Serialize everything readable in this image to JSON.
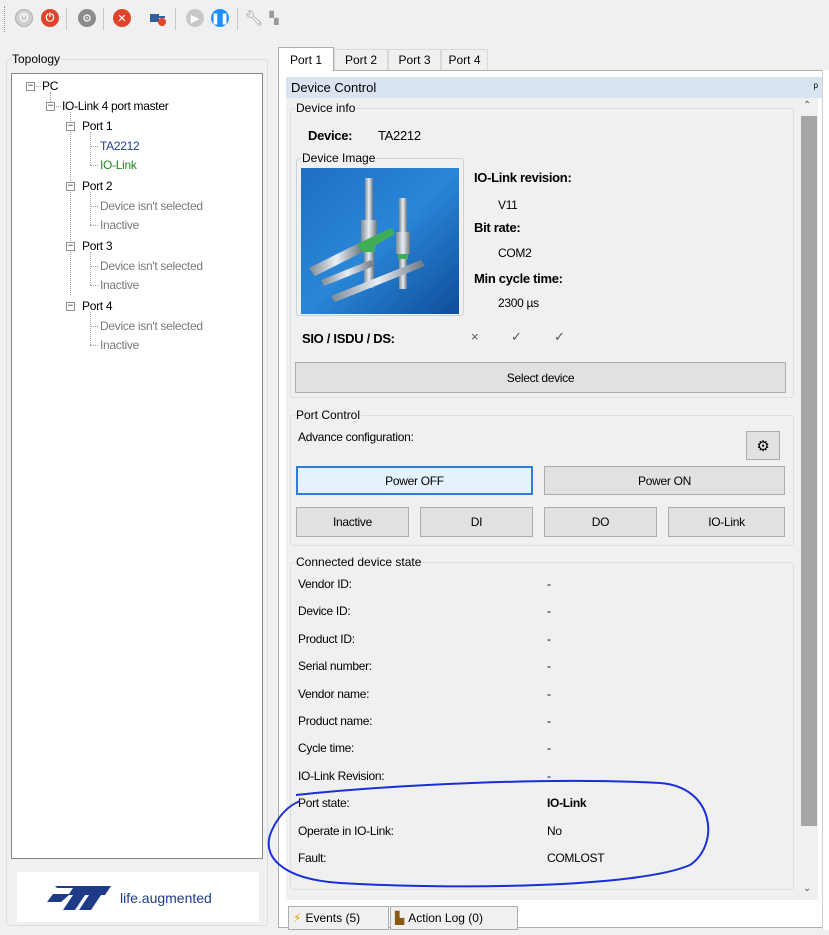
{
  "toolbar": {
    "buttons": [
      {
        "icon": "power-disabled-icon",
        "color": "#c8c8c8"
      },
      {
        "icon": "power-icon",
        "color": "#e0442a"
      },
      {
        "icon": "settings-gear-icon",
        "color": "#7a7a7a"
      },
      {
        "icon": "stop-icon",
        "color": "#e0442a"
      },
      {
        "icon": "disconnect-plug-icon",
        "color": "#2f5f9e"
      },
      {
        "icon": "play-disabled-icon",
        "color": "#c8c8c8"
      },
      {
        "icon": "pause-icon",
        "color": "#1e90ff"
      },
      {
        "icon": "wrench-icon",
        "color": "#9a9a9a"
      },
      {
        "icon": "network-icon",
        "color": "#9a9a9a"
      }
    ]
  },
  "topology": {
    "title": "Topology",
    "tree": {
      "root": "PC",
      "master": "IO-Link 4 port master",
      "ports": [
        {
          "label": "Port 1",
          "device": "TA2212",
          "state": "IO-Link"
        },
        {
          "label": "Port 2",
          "device": "Device isn't selected",
          "state": "Inactive"
        },
        {
          "label": "Port 3",
          "device": "Device isn't selected",
          "state": "Inactive"
        },
        {
          "label": "Port 4",
          "device": "Device isn't selected",
          "state": "Inactive"
        }
      ]
    },
    "logo_text": "life.augmented"
  },
  "tabs": [
    "Port 1",
    "Port 2",
    "Port 3",
    "Port 4"
  ],
  "device_control": {
    "title": "Device Control",
    "device_info": {
      "title": "Device info",
      "device_label": "Device:",
      "device_value": "TA2212",
      "image_title": "Device Image",
      "iolink_revision_label": "IO-Link revision:",
      "iolink_revision_value": "V11",
      "bit_rate_label": "Bit rate:",
      "bit_rate_value": "COM2",
      "min_cycle_label": "Min cycle time:",
      "min_cycle_value": "2300 µs",
      "sio_label": "SIO / ISDU / DS:",
      "sio_marks": [
        "×",
        "✓",
        "✓"
      ],
      "select_button": "Select device"
    },
    "port_control": {
      "title": "Port Control",
      "advance_label": "Advance configuration:",
      "power_off": "Power OFF",
      "power_on": "Power ON",
      "modes": [
        "Inactive",
        "DI",
        "DO",
        "IO-Link"
      ]
    },
    "connected_state": {
      "title": "Connected device state",
      "rows": [
        {
          "label": "Vendor ID:",
          "value": "-"
        },
        {
          "label": "Device ID:",
          "value": "-"
        },
        {
          "label": "Product ID:",
          "value": "-"
        },
        {
          "label": "Serial number:",
          "value": "-"
        },
        {
          "label": "Vendor name:",
          "value": "-"
        },
        {
          "label": "Product name:",
          "value": "-"
        },
        {
          "label": "Cycle time:",
          "value": "-"
        },
        {
          "label": "IO-Link Revision:",
          "value": "-"
        },
        {
          "label": "Port state:",
          "value": "IO-Link"
        },
        {
          "label": "Operate in IO-Link:",
          "value": "No"
        },
        {
          "label": "Fault:",
          "value": "COMLOST"
        }
      ]
    }
  },
  "bottom_tabs": [
    "Events (5)",
    "Action Log (0)"
  ],
  "colors": {
    "annotation": "#1a2fd6",
    "header": "#d9e4f0",
    "focus": "#2f7dd6"
  }
}
